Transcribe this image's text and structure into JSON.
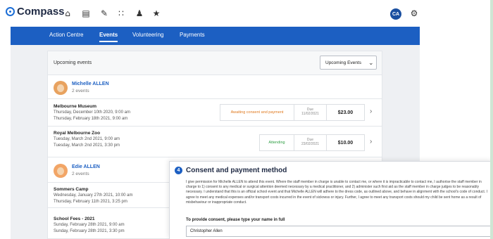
{
  "app": {
    "name": "Compass"
  },
  "topbar": {
    "icons": [
      "home-icon",
      "calendar-icon",
      "pen-icon",
      "grid-icon",
      "people-icon",
      "star-icon"
    ],
    "user_initials": "CA",
    "settings_icon": "gear-icon"
  },
  "nav": {
    "tabs": [
      {
        "label": "Action Centre",
        "active": false
      },
      {
        "label": "Events",
        "active": true
      },
      {
        "label": "Volunteering",
        "active": false
      },
      {
        "label": "Payments",
        "active": false
      }
    ]
  },
  "events_panel": {
    "title": "Upcoming events",
    "filter_selected": "Upcoming Events",
    "people": [
      {
        "name": "Michelle ALLEN",
        "count": "2 events",
        "events": [
          {
            "title": "Melbourne Museum",
            "start": "Thursday, December 10th 2020, 9:00 am",
            "end": "Thursday, February 18th 2021, 9:00 am",
            "status": "Awaiting consent and payment",
            "status_color": "#e07a1f",
            "due_label": "Due",
            "due_date": "11/02/2021",
            "amount": "$23.00"
          },
          {
            "title": "Royal Melbourne Zoo",
            "start": "Tuesday, March 2nd 2021, 9:00 am",
            "end": "Tuesday, March 2nd 2021, 3:30 pm",
            "status": "Attending",
            "status_color": "#2f9e44",
            "due_label": "Due",
            "due_date": "23/02/2021",
            "amount": "$10.00"
          }
        ]
      },
      {
        "name": "Edie ALLEN",
        "count": "2 events",
        "events": [
          {
            "title": "Sommers Camp",
            "start": "Wednesday, January 27th 2021, 10:00 am",
            "end": "Thursday, February 11th 2021, 3:25 pm"
          },
          {
            "title": "School Fees - 2021",
            "start": "Sunday, February 28th 2021, 9:00 am",
            "end": "Sunday, February 28th 2021, 3:30 pm"
          }
        ]
      }
    ]
  },
  "consent": {
    "step": "4",
    "title": "Consent and payment method",
    "body": "I give permission for Michelle ALLEN to attend this event. Where the staff member in charge is unable to contact me, or where it is impracticable to contact me, I authorise the staff member in charge to 1) consent to any medical or surgical attention deemed necessary by a medical practitioner, and 2) administer such first aid as the staff member in charge judges to be reasonably necessary. I understand that this is an official school event and that Michelle ALLEN will adhere to the dress code, as outlined above, and behave in alignment with the school's code of conduct. I agree to meet any medical expenses and/or transport costs incurred in the event of sickness or injury. Further, I agree to meet any transport costs should my child be sent home as a result of misbehaviour or inappropriate conduct.",
    "name_label": "To provide consent, please type your name in full",
    "name_value": "Christopher Allen"
  },
  "colors": {
    "nav": "#1c5fc2",
    "brand": "#1c6ed6"
  }
}
